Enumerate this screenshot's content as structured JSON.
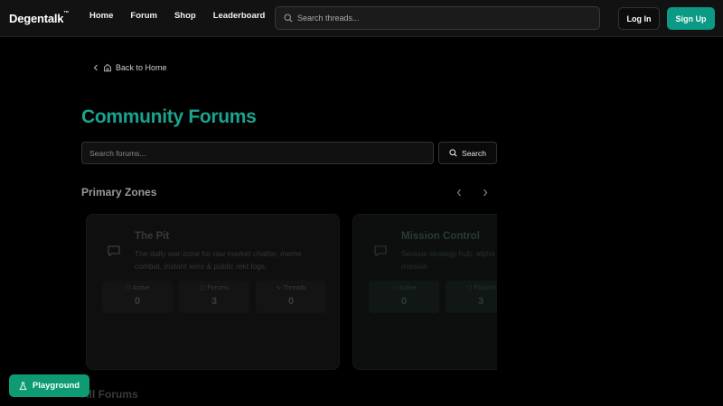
{
  "header": {
    "logo": "Degentalk",
    "logo_tm": "™",
    "nav": [
      "Home",
      "Forum",
      "Shop",
      "Leaderboard"
    ],
    "search_placeholder": "Search threads...",
    "login": "Log In",
    "signup": "Sign Up",
    "accent": "#0b9a86"
  },
  "back_link": "Back to Home",
  "page_title": "Community Forums",
  "forum_search": {
    "placeholder": "Search forums...",
    "button": "Search"
  },
  "primary_zones": {
    "title": "Primary Zones",
    "cards": [
      {
        "name": "The Pit",
        "description": "The daily war-zone for raw market chatter, meme combat, instant wins & public rekt logs.",
        "stats": [
          {
            "label": "Active",
            "value": "0",
            "icon": "user-icon"
          },
          {
            "label": "Forums",
            "value": "3",
            "icon": "chat-icon"
          },
          {
            "label": "Threads",
            "value": "0",
            "icon": "activity-icon"
          }
        ]
      },
      {
        "name": "Mission Control",
        "description": "Serious strategy hub: alpha research dumps, daily mission",
        "stats": [
          {
            "label": "Active",
            "value": "0",
            "icon": "user-icon"
          },
          {
            "label": "Forums",
            "value": "3",
            "icon": "chat-icon"
          }
        ]
      }
    ]
  },
  "all_forums_title": "All Forums",
  "playground_button": "Playground",
  "title_color": "#1aa38e",
  "playground_color": "#0e9a72"
}
